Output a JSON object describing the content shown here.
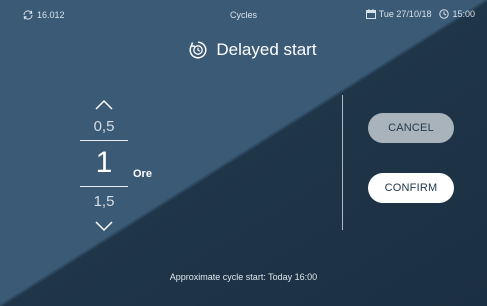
{
  "status_bar": {
    "program_code": "16.012",
    "section_title": "Cycles",
    "date": "Tue 27/10/18",
    "time": "15:00",
    "icons": [
      "sync-icon",
      "calendar-icon",
      "clock-icon"
    ]
  },
  "title": {
    "label": "Delayed start",
    "icon": "timer-icon"
  },
  "picker": {
    "previous_value": "0,5",
    "current_value": "1",
    "next_value": "1,5",
    "unit": "Ore"
  },
  "actions": {
    "cancel_label": "CANCEL",
    "confirm_label": "CONFIRM"
  },
  "footer": {
    "text": "Approximate cycle start: Today 16:00"
  },
  "colors": {
    "background_light": "#3a5a76",
    "background_dark": "#1f3548",
    "cancel_button": "#a9b3bc",
    "confirm_button": "#ffffff"
  }
}
